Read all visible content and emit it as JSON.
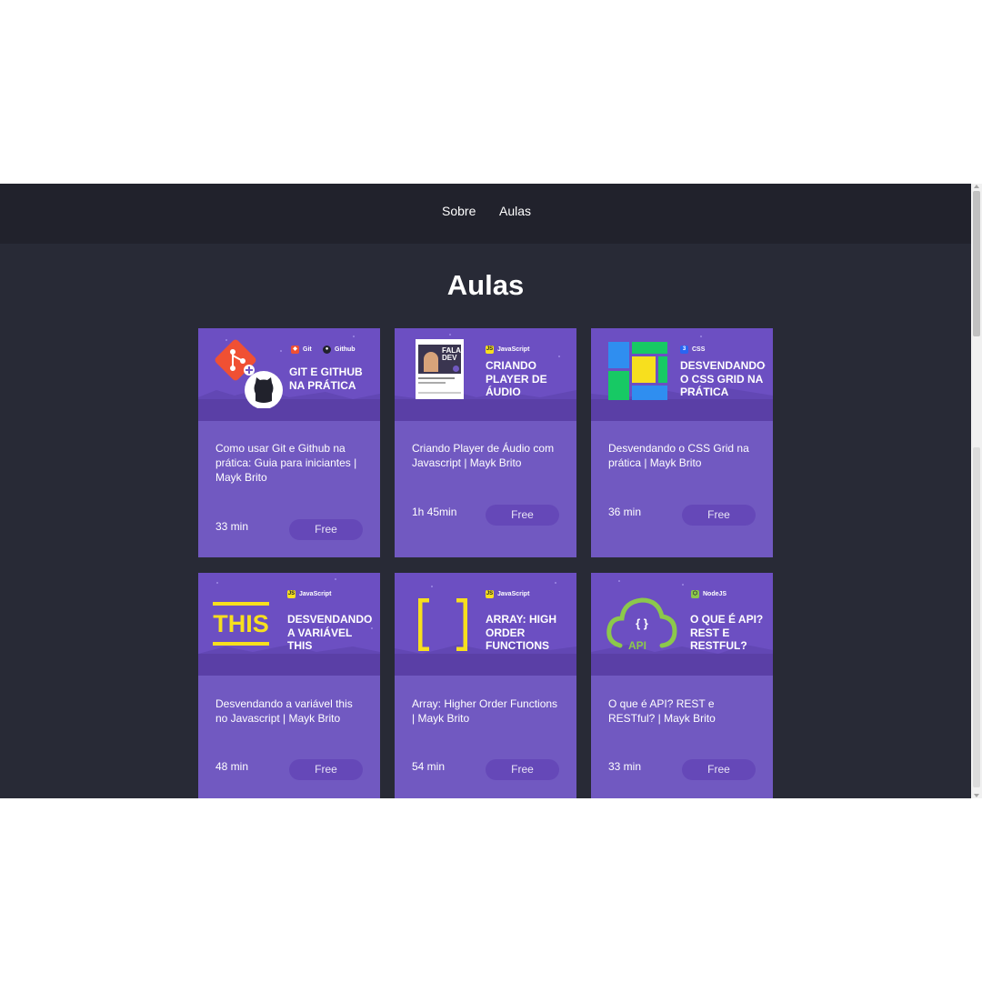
{
  "nav": {
    "links": [
      "Sobre",
      "Aulas"
    ]
  },
  "page": {
    "title": "Aulas"
  },
  "cards": [
    {
      "thumb_title": "GIT E GITHUB NA PRÁTICA",
      "tags": [
        "Git",
        "Github"
      ],
      "title": "Como usar Git e Github na prática: Guia para iniciantes | Mayk Brito",
      "duration": "33 min",
      "price": "Free",
      "art_icon": "git-github-logo-icon"
    },
    {
      "thumb_title": "CRIANDO PLAYER DE ÁUDIO",
      "tags": [
        "JavaScript"
      ],
      "title": "Criando Player de Áudio com Javascript | Mayk Brito",
      "duration": "1h 45min",
      "price": "Free",
      "art_icon": "audio-player-mockup-icon",
      "mockup_label": "FALA DEV"
    },
    {
      "thumb_title": "DESVENDANDO O CSS GRID NA PRÁTICA",
      "tags": [
        "CSS"
      ],
      "title": "Desvendando o CSS Grid na prática | Mayk Brito",
      "duration": "36 min",
      "price": "Free",
      "art_icon": "css-grid-blocks-icon"
    },
    {
      "thumb_title": "DESVENDANDO A VARIÁVEL THIS",
      "tags": [
        "JavaScript"
      ],
      "title": "Desvendando a variável this no Javascript | Mayk Brito",
      "duration": "48 min",
      "price": "Free",
      "art_icon": "this-keyword-icon",
      "art_text": "THIS"
    },
    {
      "thumb_title": "ARRAY: HIGH ORDER FUNCTIONS",
      "tags": [
        "JavaScript"
      ],
      "title": "Array: Higher Order Functions | Mayk Brito",
      "duration": "54 min",
      "price": "Free",
      "art_icon": "array-brackets-icon"
    },
    {
      "thumb_title": "O QUE É API? REST E RESTFUL?",
      "tags": [
        "NodeJS"
      ],
      "title": "O que é API? REST e RESTful? | Mayk Brito",
      "duration": "33 min",
      "price": "Free",
      "art_icon": "api-cloud-icon",
      "art_text": "API"
    }
  ],
  "colors": {
    "navbar_bg": "#21222c",
    "page_bg": "#282a36",
    "card_bg": "#7159c1",
    "button_bg": "#6548b8",
    "git_red": "#f05033",
    "js_yellow": "#f7df1e",
    "node_green": "#8cc84b",
    "css_blue": "#2965f1"
  }
}
